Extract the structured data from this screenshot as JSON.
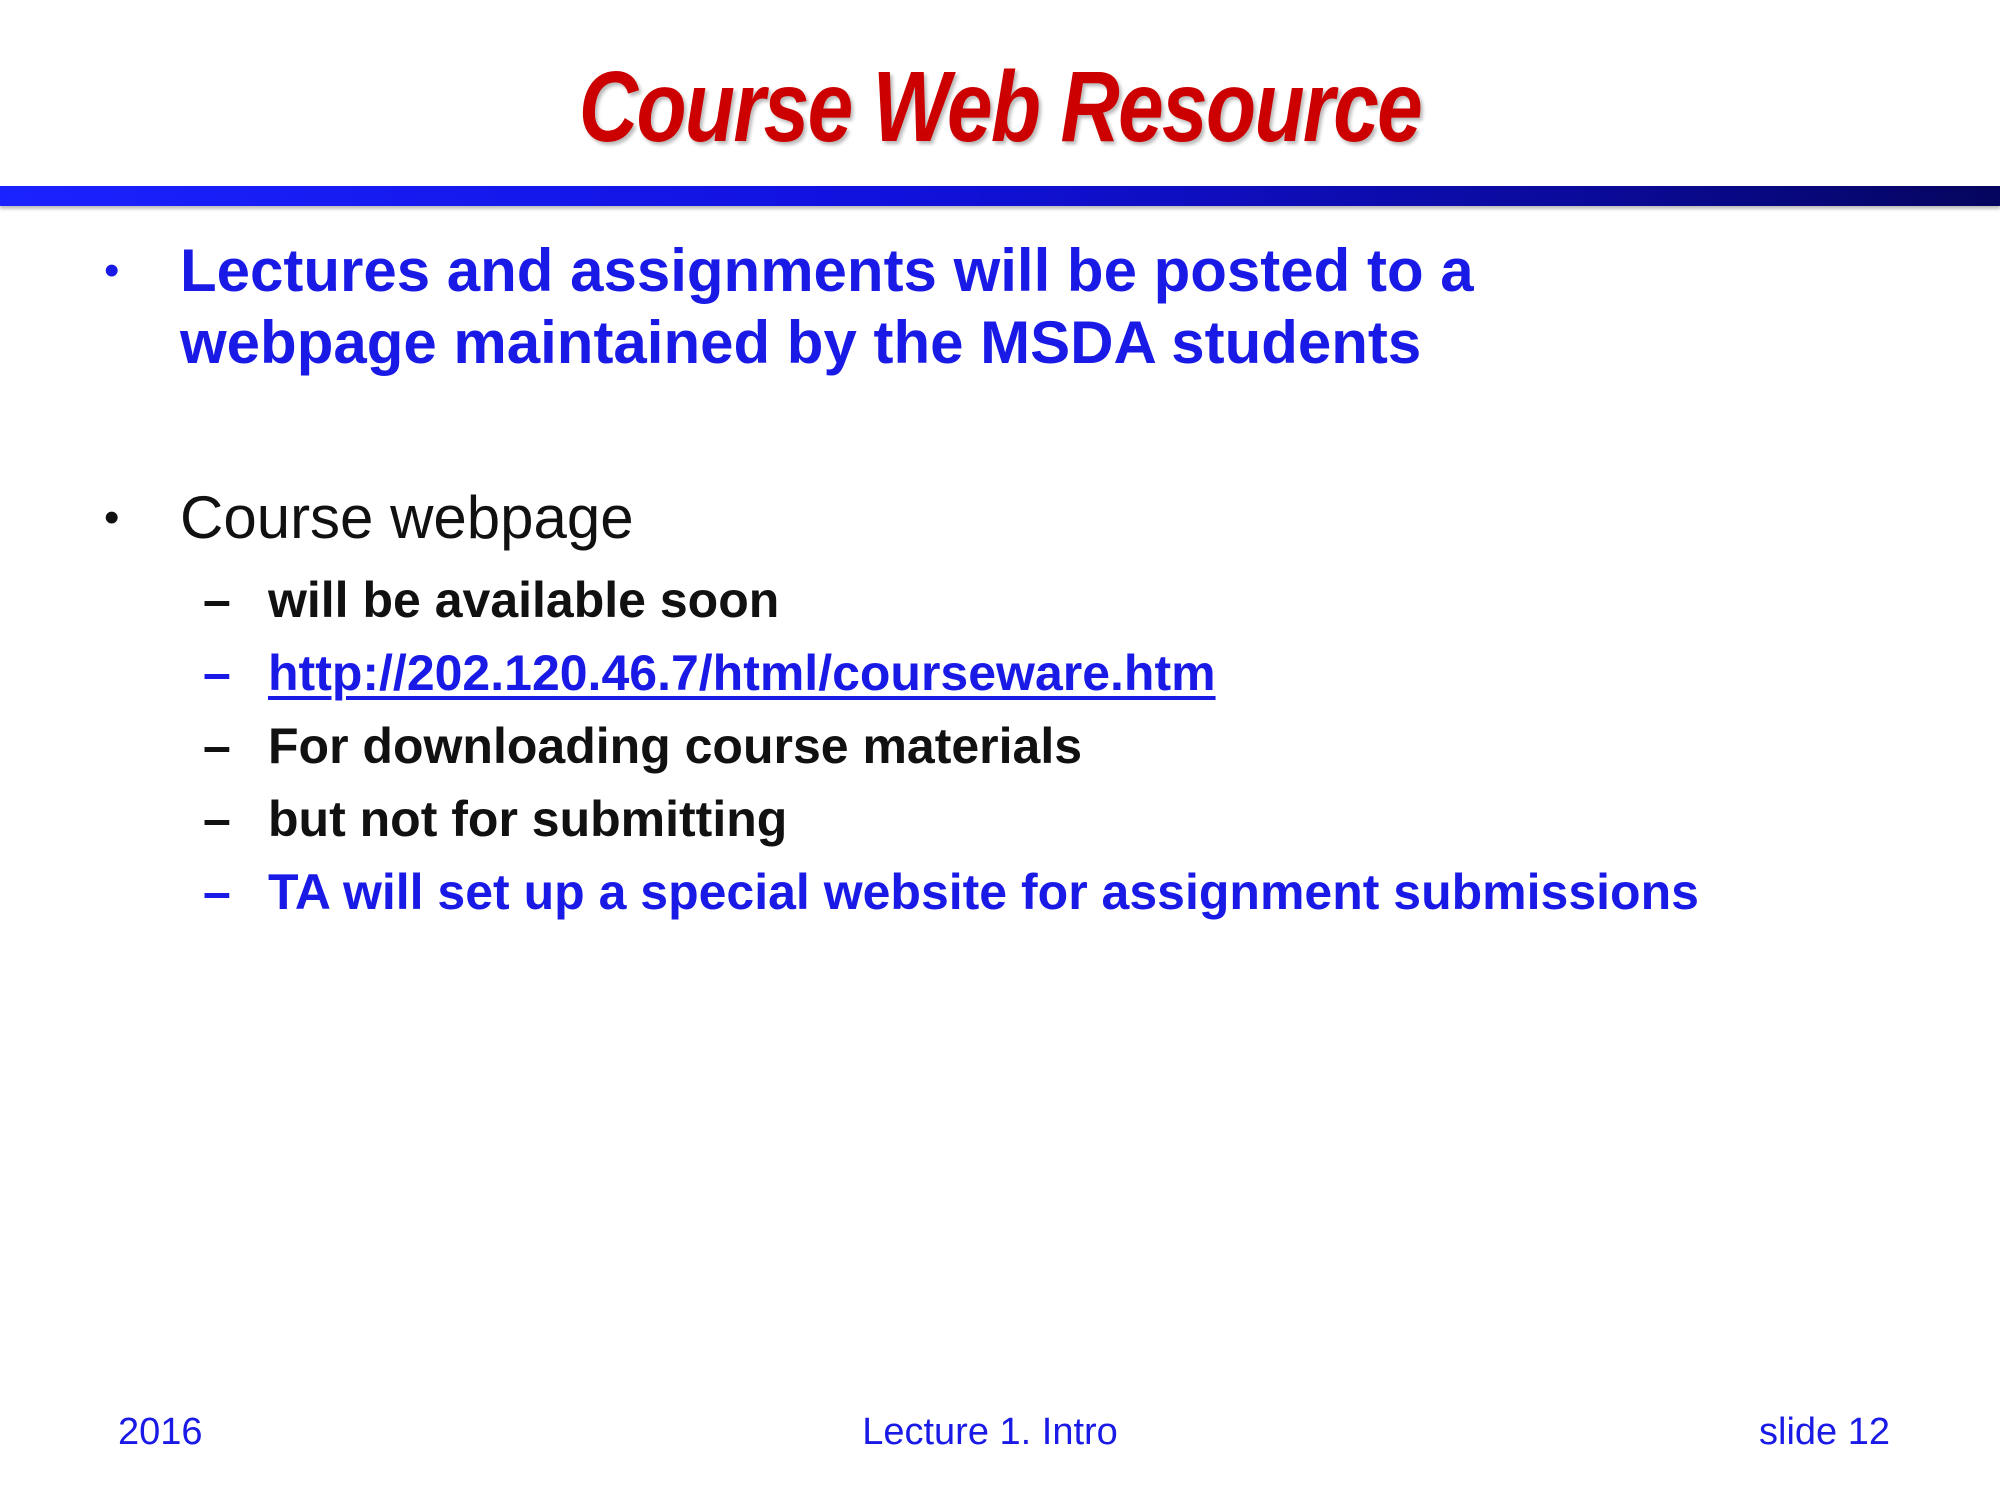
{
  "slide": {
    "title": "Course Web Resource",
    "bullets": [
      {
        "marker": "•",
        "lines": [
          "Lectures and assignments will be posted to a",
          "webpage maintained by the MSDA students"
        ]
      },
      {
        "marker": "•",
        "text": "Course webpage",
        "sub_items": [
          {
            "marker": "–",
            "text": "will be available soon"
          },
          {
            "marker": "–",
            "text": "http://202.120.46.7/html/courseware.htm"
          },
          {
            "marker": "–",
            "text": "For downloading course materials"
          },
          {
            "marker": "–",
            "text": "but not for submitting"
          },
          {
            "marker": "–",
            "text": "TA will set up a special website for assignment submissions"
          }
        ]
      }
    ],
    "footer": {
      "left": "2016",
      "center": "Lecture 1. Intro",
      "right": "slide 12"
    }
  },
  "colors": {
    "title": "#cc0000",
    "rule": "#1111dd",
    "highlight_text": "#1a1ae6",
    "body_text": "#111111"
  }
}
